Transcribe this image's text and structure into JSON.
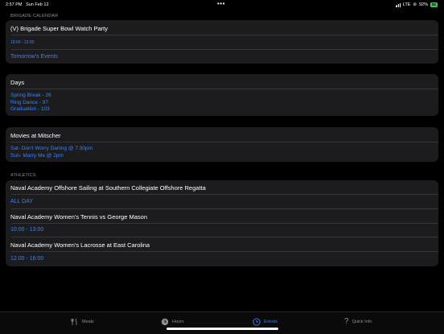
{
  "status": {
    "time": "2:57 PM",
    "date": "Sun Feb 12",
    "network": "LTE",
    "battery_pct": "92%",
    "battery_badge": "92"
  },
  "brigade": {
    "header": "BRIGADE CALENDAR",
    "event_title": "(V) Brigade Super Bowl Watch Party",
    "event_time": "18:00 - 23:00",
    "tomorrow_link": "Tomorrow's Events"
  },
  "days": {
    "title": "Days",
    "items": [
      "Spring Break - 26",
      "Ring Dance - 97",
      "Graduation - 103"
    ]
  },
  "movies": {
    "title": "Movies at Mitscher",
    "items": [
      "Sat- Don't Worry Darling @ 7:30pm",
      "Sun- Marry Me @ 2pm"
    ]
  },
  "athletics": {
    "header": "ATHLETICS",
    "events": [
      {
        "title": "Naval Academy Offshore Sailing at Southern Collegiate Offshore Regatta",
        "time": "ALL DAY"
      },
      {
        "title": "Naval Academy Women's Tennis vs George Mason",
        "time": "10:00 - 13:00"
      },
      {
        "title": "Naval Academy Women's Lacrosse at East Carolina",
        "time": "12:00 - 16:00"
      }
    ]
  },
  "tabs": [
    {
      "label": "Meals",
      "icon": "fork-knife-icon"
    },
    {
      "label": "Hours",
      "icon": "clock-icon"
    },
    {
      "label": "Events",
      "icon": "calendar-clock-icon"
    },
    {
      "label": "Quick Info",
      "icon": "question-mark-icon"
    }
  ],
  "colors": {
    "accent": "#3b82f6",
    "card": "#1c1c1e",
    "background": "#000000",
    "battery": "#34c759"
  }
}
